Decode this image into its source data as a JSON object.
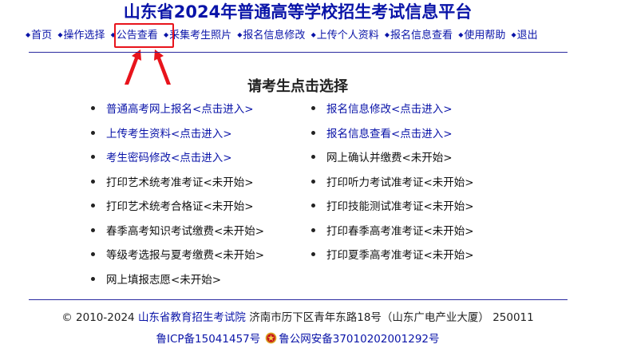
{
  "header": {
    "title": "山东省2024年普通高等学校招生考试信息平台"
  },
  "nav": {
    "bullet": "◆",
    "items": [
      {
        "label": "首页"
      },
      {
        "label": "操作选择"
      },
      {
        "label": "公告查看"
      },
      {
        "label": "采集考生照片"
      },
      {
        "label": "报名信息修改"
      },
      {
        "label": "上传个人资料"
      },
      {
        "label": "报名信息查看"
      },
      {
        "label": "使用帮助"
      },
      {
        "label": "退出"
      }
    ]
  },
  "main": {
    "heading": "请考生点击选择",
    "left_options": [
      {
        "label": "普通高考网上报名<点击进入>"
      },
      {
        "label": "上传考生资料<点击进入>"
      },
      {
        "label": "考生密码修改<点击进入>"
      },
      {
        "label": "打印艺术统考准考证<未开始>"
      },
      {
        "label": "打印艺术统考合格证<未开始>"
      },
      {
        "label": "春季高考知识考试缴费<未开始>"
      },
      {
        "label": "等级考选报与夏考缴费<未开始>"
      },
      {
        "label": "网上填报志愿<未开始>"
      }
    ],
    "right_options": [
      {
        "label": "报名信息修改<点击进入>"
      },
      {
        "label": "报名信息查看<点击进入>"
      },
      {
        "label": "网上确认并缴费<未开始>"
      },
      {
        "label": "打印听力考试准考证<未开始>"
      },
      {
        "label": "打印技能测试准考证<未开始>"
      },
      {
        "label": "打印春季高考准考证<未开始>"
      },
      {
        "label": "打印夏季高考准考证<未开始>"
      }
    ]
  },
  "footer": {
    "copyright_prefix": "© 2010-2024",
    "org_link": "山东省教育招生考试院",
    "address": "济南市历下区青年东路18号（山东广电产业大厦） 250011",
    "icp": "鲁ICP备15041457号",
    "police": "鲁公网安备37010202001292号"
  },
  "colors": {
    "link": "#0a14a8",
    "highlight": "#e8141c",
    "text": "#222222"
  }
}
